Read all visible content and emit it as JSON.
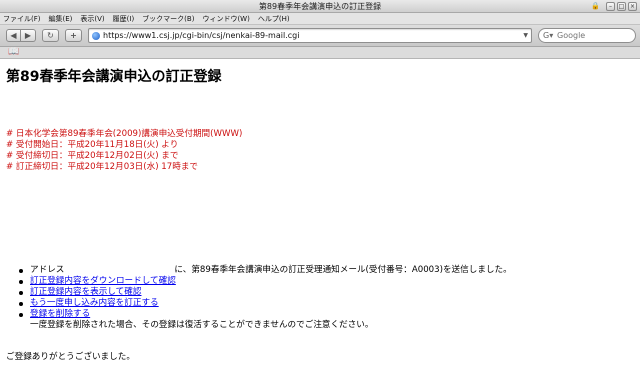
{
  "window": {
    "title": "第89春季年会講演申込の訂正登録"
  },
  "menu": [
    "ファイル(F)",
    "編集(E)",
    "表示(V)",
    "履歴(I)",
    "ブックマーク(B)",
    "ウィンドウ(W)",
    "ヘルプ(H)"
  ],
  "toolbar": {
    "url": "https://www1.csj.jp/cgi-bin/csj/nenkai-89-mail.cgi",
    "search_placeholder": "Google"
  },
  "page": {
    "title": "第89春季年会講演申込の訂正登録",
    "notices": [
      "# 日本化学会第89春季年会(2009)講演申込受付期間(WWW)",
      "# 受付開始日：平成20年11月18日(火) より",
      "# 受付締切日：平成20年12月02日(火) まで",
      "# 訂正締切日：平成20年12月03日(水) 17時まで"
    ],
    "address_label": "アドレス",
    "address_message": "に、第89春季年会講演申込の訂正受理通知メール(受付番号：A0003)を送信しました。",
    "links": [
      "訂正登録内容をダウンロードして確認",
      "訂正登録内容を表示して確認",
      "もう一度申し込み内容を訂正する",
      "登録を削除する"
    ],
    "delete_note": "一度登録を削除された場合、その登録は復活することができませんのでご注意ください。",
    "thanks": "ご登録ありがとうございました。"
  },
  "colors": {
    "notice": "#cc1111",
    "link": "#0000ee"
  }
}
